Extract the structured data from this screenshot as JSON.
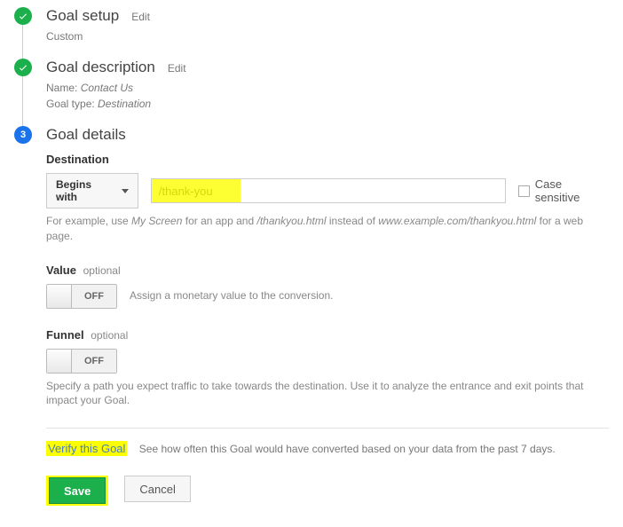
{
  "steps": {
    "setup": {
      "title": "Goal setup",
      "edit": "Edit",
      "sub": "Custom"
    },
    "description": {
      "title": "Goal description",
      "edit": "Edit",
      "name_label": "Name:",
      "name_value": "Contact Us",
      "type_label": "Goal type:",
      "type_value": "Destination"
    },
    "details": {
      "title": "Goal details",
      "number": "3"
    }
  },
  "destination": {
    "heading": "Destination",
    "match_option": "Begins with",
    "value": "/thank-you",
    "case_sensitive": "Case sensitive",
    "hint_prefix": "For example, use ",
    "hint_i1": "My Screen",
    "hint_mid1": " for an app and ",
    "hint_i2": "/thankyou.html",
    "hint_mid2": " instead of ",
    "hint_i3": "www.example.com/thankyou.html",
    "hint_suffix": " for a web page."
  },
  "value_section": {
    "heading": "Value",
    "optional": "optional",
    "toggle": "OFF",
    "hint": "Assign a monetary value to the conversion."
  },
  "funnel_section": {
    "heading": "Funnel",
    "optional": "optional",
    "toggle": "OFF",
    "hint": "Specify a path you expect traffic to take towards the destination. Use it to analyze the entrance and exit points that impact your Goal."
  },
  "verify": {
    "link": "Verify this Goal",
    "hint": "See how often this Goal would have converted based on your data from the past 7 days."
  },
  "buttons": {
    "save": "Save",
    "cancel": "Cancel"
  }
}
